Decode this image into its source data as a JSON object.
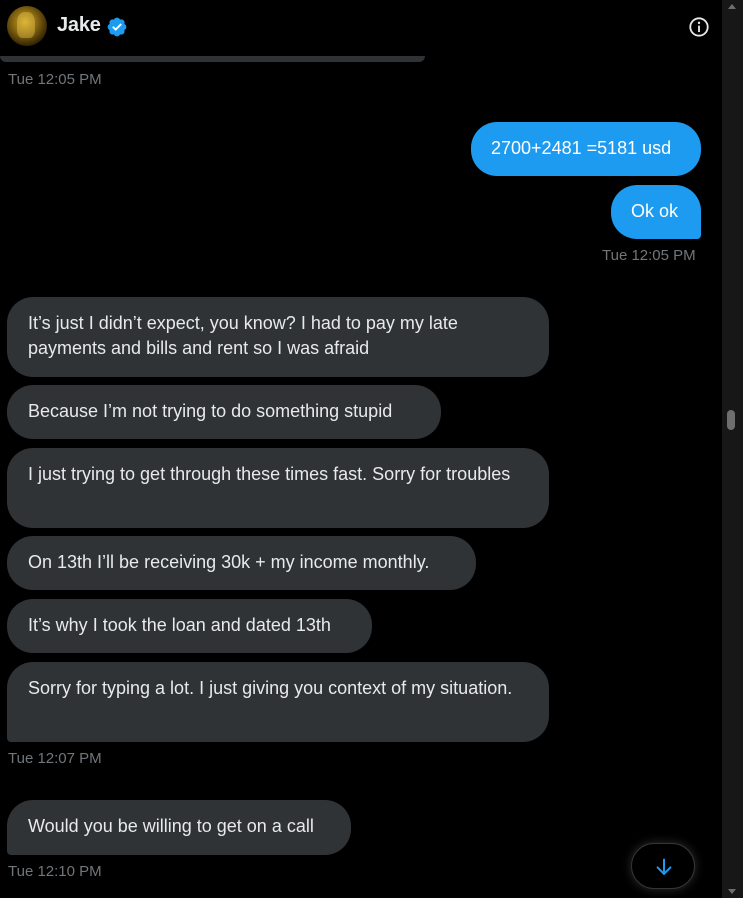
{
  "header": {
    "name": "Jake",
    "verified_icon": "verified-badge-icon",
    "info_icon": "info-icon"
  },
  "colors": {
    "background": "#000000",
    "incoming_bubble": "#2f3336",
    "outgoing_bubble": "#1d9bf0",
    "timestamp": "#71767b",
    "verified": "#1d9bf0"
  },
  "conversation": {
    "timestamps": [
      "Tue 12:05 PM",
      "Tue 12:05 PM",
      "Tue 12:07 PM",
      "Tue 12:10 PM"
    ],
    "outgoing": [
      "2700+2481 =5181 usd",
      "Ok ok"
    ],
    "incoming": [
      "It’s just I didn’t expect, you know? I had to pay my late payments and bills and rent so I was afraid",
      "Because I’m not trying to do something stupid",
      "I just trying to get through these times fast. Sorry for troubles",
      "On 13th I’ll be receiving 30k + my income monthly.",
      "It’s why I took the loan and dated 13th",
      "Sorry for typing a lot. I just giving you context of my situation.",
      "Would you be willing to get on a call"
    ]
  },
  "scroll_down_button": {
    "icon": "arrow-down-icon"
  }
}
